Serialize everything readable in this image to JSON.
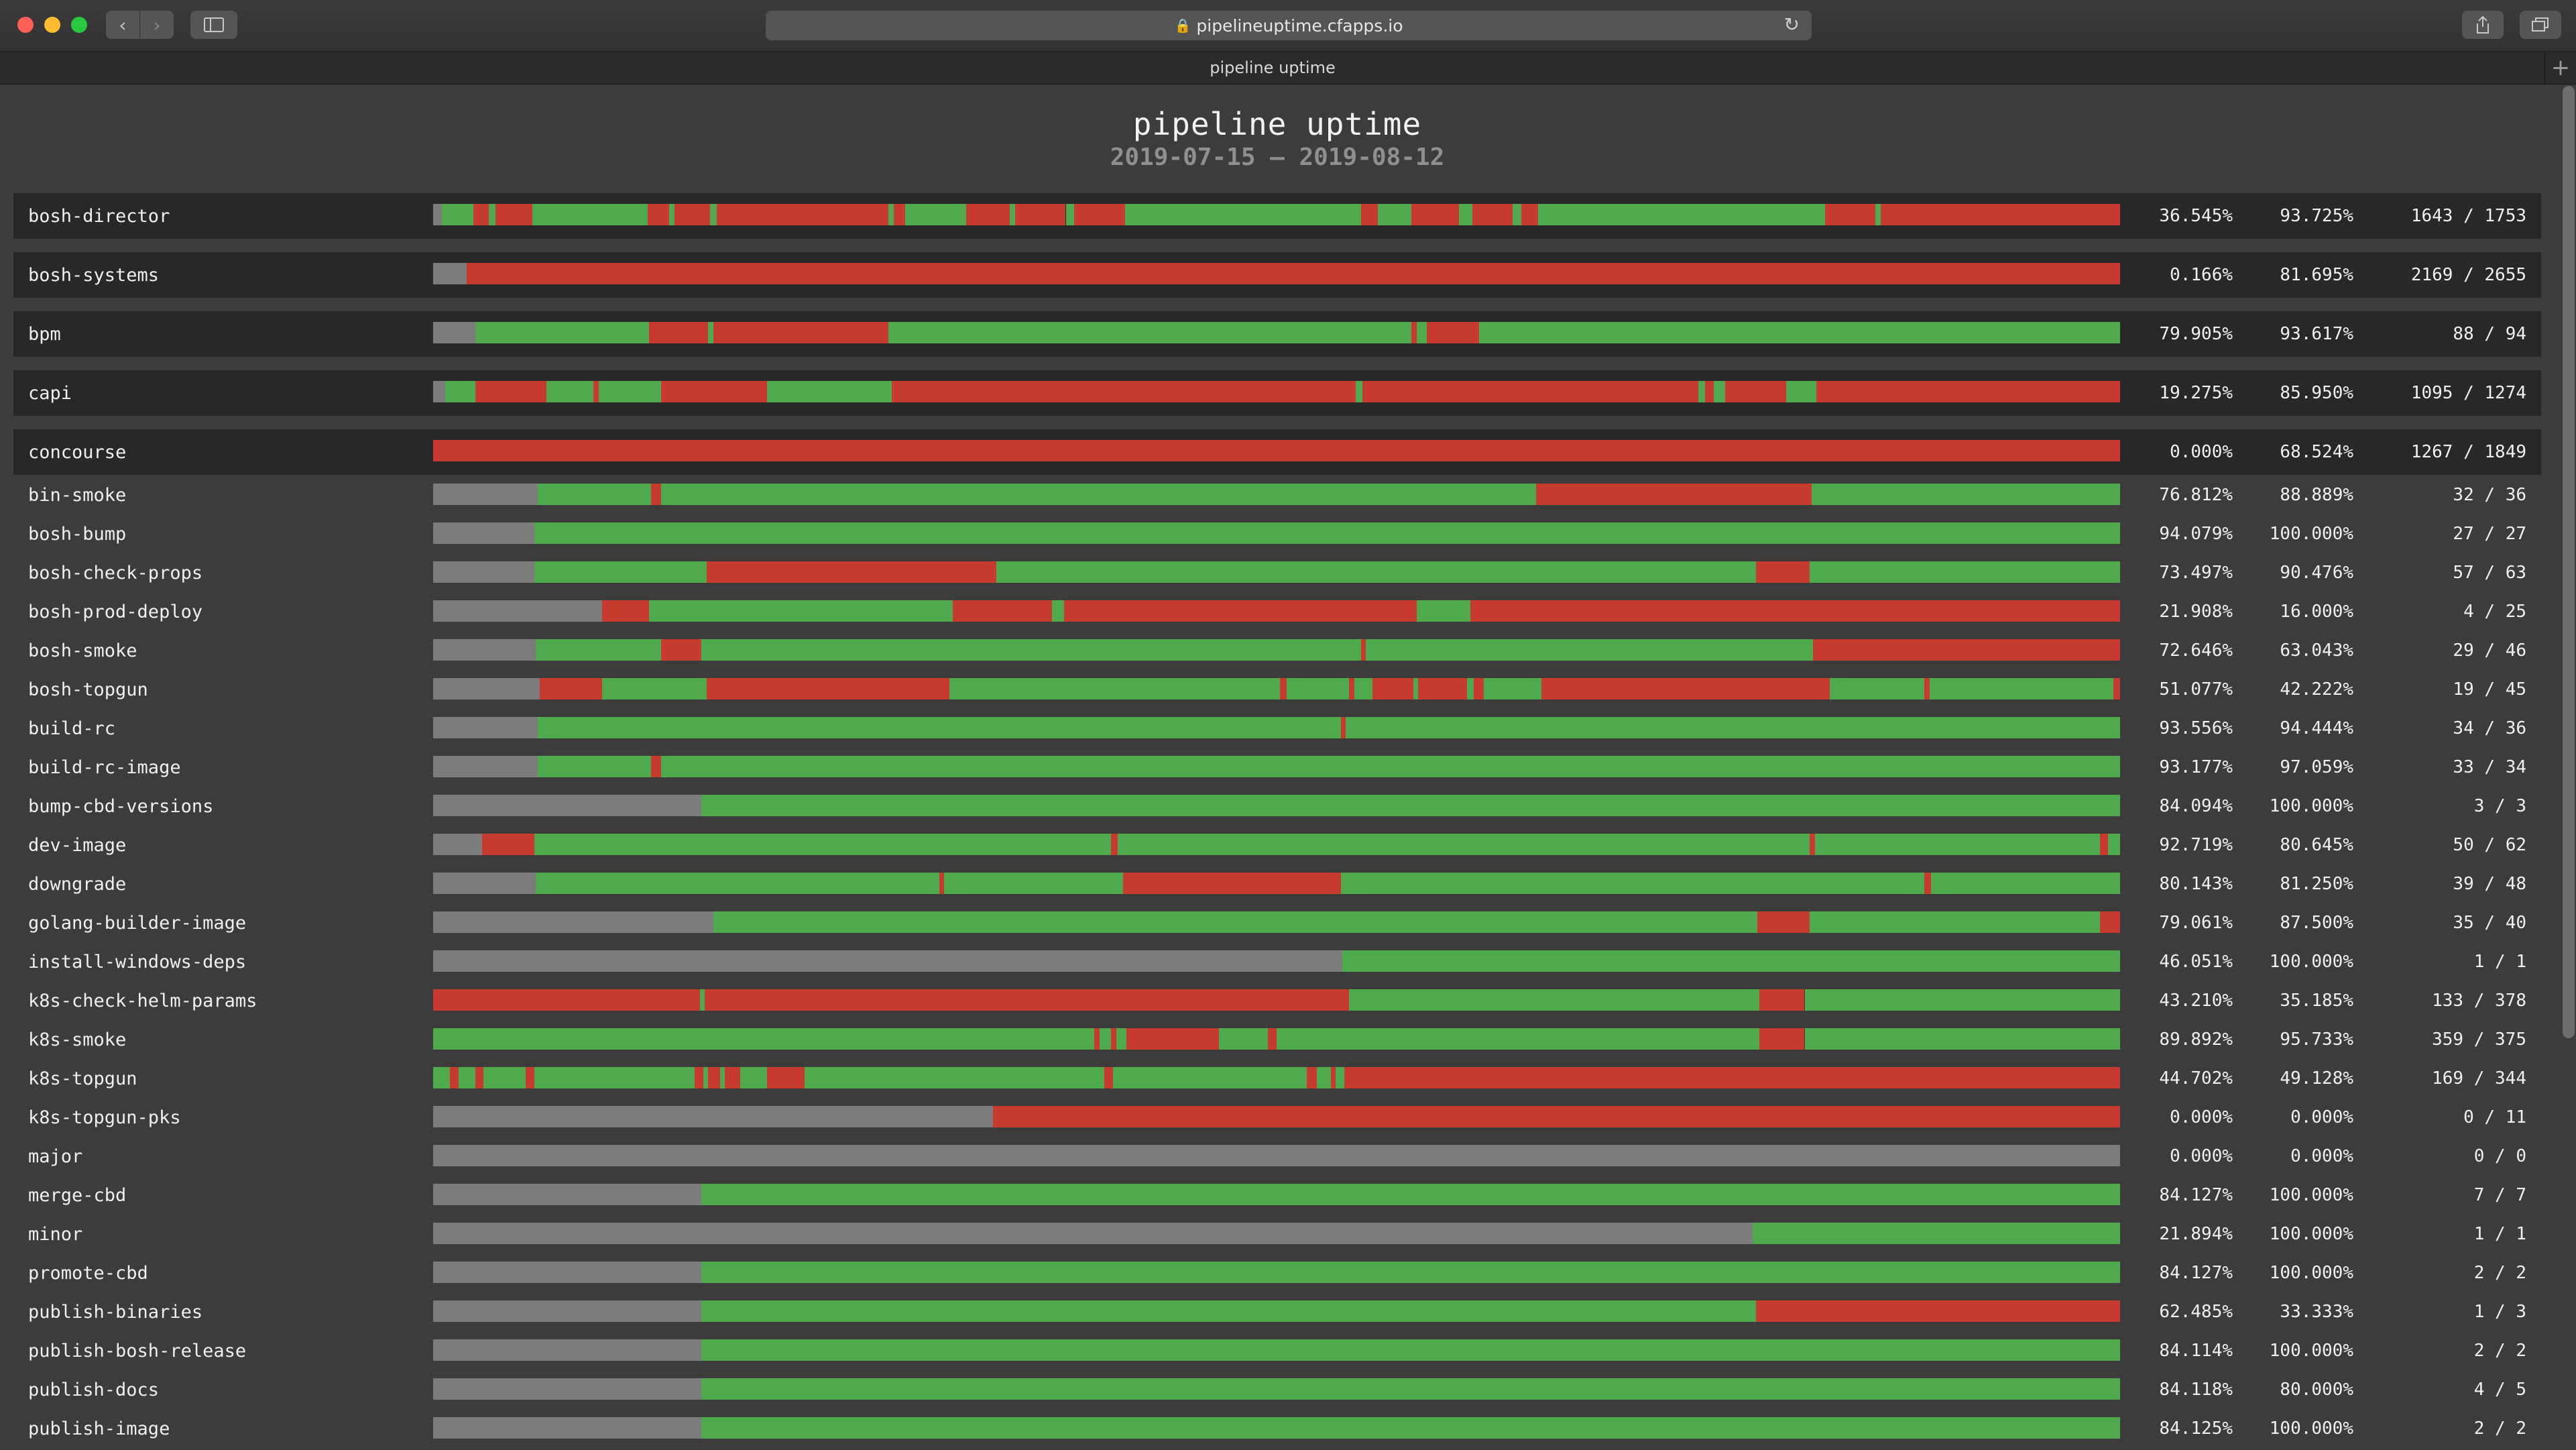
{
  "browser": {
    "url": "pipelineuptime.cfapps.io",
    "tab_title": "pipeline uptime"
  },
  "page": {
    "title": "pipeline uptime",
    "date_range": "2019-07-15 — 2019-08-12"
  },
  "colors": {
    "success": "#4fa94d",
    "failure": "#c63a30",
    "no_data": "#7c7c7c"
  },
  "pipelines": [
    {
      "name": "bosh-director",
      "pct1": "36.545%",
      "pct2": "93.725%",
      "count": "1643 / 1753",
      "timeline": [
        [
          "n",
          0,
          0.5
        ],
        [
          "g",
          0.5,
          2.4
        ],
        [
          "r",
          2.4,
          3.3
        ],
        [
          "g",
          3.3,
          3.7
        ],
        [
          "r",
          3.7,
          5.9
        ],
        [
          "g",
          5.9,
          12.7
        ],
        [
          "r",
          12.7,
          14.0
        ],
        [
          "g",
          14.0,
          14.3
        ],
        [
          "r",
          14.3,
          16.4
        ],
        [
          "g",
          16.4,
          16.8
        ],
        [
          "r",
          16.8,
          27.0
        ],
        [
          "g",
          27.0,
          27.3
        ],
        [
          "r",
          27.3,
          28.0
        ],
        [
          "g",
          28.0,
          31.6
        ],
        [
          "r",
          31.6,
          34.2
        ],
        [
          "g",
          34.2,
          34.5
        ],
        [
          "r",
          34.5,
          37.5
        ],
        [
          "g",
          37.5,
          38.0
        ],
        [
          "r",
          38.0,
          41.0
        ],
        [
          "g",
          41.0,
          55.0
        ],
        [
          "r",
          55.0,
          56.0
        ],
        [
          "g",
          56.0,
          58.0
        ],
        [
          "r",
          58.0,
          60.8
        ],
        [
          "g",
          60.8,
          61.6
        ],
        [
          "r",
          61.6,
          64.0
        ],
        [
          "g",
          64.0,
          64.5
        ],
        [
          "r",
          64.5,
          65.5
        ],
        [
          "g",
          65.5,
          82.5
        ],
        [
          "r",
          82.5,
          85.5
        ],
        [
          "g",
          85.5,
          85.8
        ],
        [
          "r",
          85.8,
          100
        ]
      ]
    },
    {
      "name": "bosh-systems",
      "pct1": "0.166%",
      "pct2": "81.695%",
      "count": "2169 / 2655",
      "timeline": [
        [
          "n",
          0,
          2.0
        ],
        [
          "r",
          2.0,
          100
        ]
      ]
    },
    {
      "name": "bpm",
      "pct1": "79.905%",
      "pct2": "93.617%",
      "count": "88 / 94",
      "timeline": [
        [
          "n",
          0,
          2.5
        ],
        [
          "g",
          2.5,
          12.8
        ],
        [
          "r",
          12.8,
          16.3
        ],
        [
          "g",
          16.3,
          16.6
        ],
        [
          "r",
          16.6,
          27.0
        ],
        [
          "g",
          27.0,
          58.0
        ],
        [
          "r",
          58.0,
          58.3
        ],
        [
          "g",
          58.3,
          58.9
        ],
        [
          "r",
          58.9,
          62.0
        ],
        [
          "g",
          62.0,
          100
        ]
      ]
    },
    {
      "name": "capi",
      "pct1": "19.275%",
      "pct2": "85.950%",
      "count": "1095 / 1274",
      "timeline": [
        [
          "n",
          0,
          0.7
        ],
        [
          "g",
          0.7,
          2.5
        ],
        [
          "r",
          2.5,
          6.7
        ],
        [
          "g",
          6.7,
          9.5
        ],
        [
          "r",
          9.5,
          9.8
        ],
        [
          "g",
          9.8,
          13.5
        ],
        [
          "r",
          13.5,
          19.8
        ],
        [
          "g",
          19.8,
          27.2
        ],
        [
          "r",
          27.2,
          54.7
        ],
        [
          "g",
          54.7,
          55.1
        ],
        [
          "r",
          55.1,
          75.0
        ],
        [
          "g",
          75.0,
          75.4
        ],
        [
          "r",
          75.4,
          75.9
        ],
        [
          "g",
          75.9,
          76.6
        ],
        [
          "r",
          76.6,
          80.2
        ],
        [
          "g",
          80.2,
          82.0
        ],
        [
          "r",
          82.0,
          100
        ]
      ]
    },
    {
      "name": "concourse",
      "pct1": "0.000%",
      "pct2": "68.524%",
      "count": "1267 / 1849",
      "timeline": [
        [
          "r",
          0,
          100
        ]
      ]
    },
    {
      "name": "bin-smoke",
      "pct1": "76.812%",
      "pct2": "88.889%",
      "count": "32 / 36",
      "timeline": [
        [
          "n",
          0,
          6.2
        ],
        [
          "g",
          6.2,
          12.9
        ],
        [
          "r",
          12.9,
          13.5
        ],
        [
          "g",
          13.5,
          65.4
        ],
        [
          "r",
          65.4,
          81.7
        ],
        [
          "g",
          81.7,
          100
        ]
      ]
    },
    {
      "name": "bosh-bump",
      "pct1": "94.079%",
      "pct2": "100.000%",
      "count": "27 / 27",
      "timeline": [
        [
          "n",
          0,
          6.0
        ],
        [
          "g",
          6.0,
          100
        ]
      ]
    },
    {
      "name": "bosh-check-props",
      "pct1": "73.497%",
      "pct2": "90.476%",
      "count": "57 / 63",
      "timeline": [
        [
          "n",
          0,
          6.0
        ],
        [
          "g",
          6.0,
          16.2
        ],
        [
          "r",
          16.2,
          33.4
        ],
        [
          "g",
          33.4,
          78.4
        ],
        [
          "r",
          78.4,
          81.6
        ],
        [
          "g",
          81.6,
          100
        ]
      ]
    },
    {
      "name": "bosh-prod-deploy",
      "pct1": "21.908%",
      "pct2": "16.000%",
      "count": "4 / 25",
      "timeline": [
        [
          "n",
          0,
          10.0
        ],
        [
          "r",
          10.0,
          12.8
        ],
        [
          "g",
          12.8,
          30.8
        ],
        [
          "r",
          30.8,
          36.7
        ],
        [
          "g",
          36.7,
          37.4
        ],
        [
          "r",
          37.4,
          58.3
        ],
        [
          "g",
          58.3,
          61.5
        ],
        [
          "r",
          61.5,
          100
        ]
      ]
    },
    {
      "name": "bosh-smoke",
      "pct1": "72.646%",
      "pct2": "63.043%",
      "count": "29 / 46",
      "timeline": [
        [
          "n",
          0,
          6.1
        ],
        [
          "g",
          6.1,
          13.5
        ],
        [
          "r",
          13.5,
          15.9
        ],
        [
          "g",
          15.9,
          55.0
        ],
        [
          "r",
          55.0,
          55.3
        ],
        [
          "g",
          55.3,
          81.8
        ],
        [
          "r",
          81.8,
          100
        ]
      ]
    },
    {
      "name": "bosh-topgun",
      "pct1": "51.077%",
      "pct2": "42.222%",
      "count": "19 / 45",
      "timeline": [
        [
          "n",
          0,
          6.3
        ],
        [
          "r",
          6.3,
          10.0
        ],
        [
          "g",
          10.0,
          16.2
        ],
        [
          "r",
          16.2,
          30.6
        ],
        [
          "g",
          30.6,
          50.2
        ],
        [
          "r",
          50.2,
          50.6
        ],
        [
          "g",
          50.6,
          54.3
        ],
        [
          "r",
          54.3,
          54.6
        ],
        [
          "g",
          54.6,
          55.7
        ],
        [
          "r",
          55.7,
          58.1
        ],
        [
          "g",
          58.1,
          58.4
        ],
        [
          "r",
          58.4,
          61.3
        ],
        [
          "g",
          61.3,
          61.7
        ],
        [
          "r",
          61.7,
          62.3
        ],
        [
          "g",
          62.3,
          65.7
        ],
        [
          "r",
          65.7,
          82.8
        ],
        [
          "g",
          82.8,
          88.4
        ],
        [
          "r",
          88.4,
          88.7
        ],
        [
          "g",
          88.7,
          99.6
        ],
        [
          "r",
          99.6,
          100
        ]
      ]
    },
    {
      "name": "build-rc",
      "pct1": "93.556%",
      "pct2": "94.444%",
      "count": "34 / 36",
      "timeline": [
        [
          "n",
          0,
          6.2
        ],
        [
          "g",
          6.2,
          53.8
        ],
        [
          "r",
          53.8,
          54.1
        ],
        [
          "g",
          54.1,
          100
        ]
      ]
    },
    {
      "name": "build-rc-image",
      "pct1": "93.177%",
      "pct2": "97.059%",
      "count": "33 / 34",
      "timeline": [
        [
          "n",
          0,
          6.2
        ],
        [
          "g",
          6.2,
          12.9
        ],
        [
          "r",
          12.9,
          13.5
        ],
        [
          "g",
          13.5,
          100
        ]
      ]
    },
    {
      "name": "bump-cbd-versions",
      "pct1": "84.094%",
      "pct2": "100.000%",
      "count": "3 / 3",
      "timeline": [
        [
          "n",
          0,
          15.9
        ],
        [
          "g",
          15.9,
          100
        ]
      ]
    },
    {
      "name": "dev-image",
      "pct1": "92.719%",
      "pct2": "80.645%",
      "count": "50 / 62",
      "timeline": [
        [
          "n",
          0,
          2.9
        ],
        [
          "r",
          2.9,
          6.0
        ],
        [
          "g",
          6.0,
          40.2
        ],
        [
          "r",
          40.2,
          40.6
        ],
        [
          "g",
          40.6,
          81.6
        ],
        [
          "r",
          81.6,
          81.9
        ],
        [
          "g",
          81.9,
          98.8
        ],
        [
          "r",
          98.8,
          99.3
        ],
        [
          "g",
          99.3,
          100
        ]
      ]
    },
    {
      "name": "downgrade",
      "pct1": "80.143%",
      "pct2": "81.250%",
      "count": "39 / 48",
      "timeline": [
        [
          "n",
          0,
          6.1
        ],
        [
          "g",
          6.1,
          30.0
        ],
        [
          "r",
          30.0,
          30.3
        ],
        [
          "g",
          30.3,
          40.9
        ],
        [
          "r",
          40.9,
          53.8
        ],
        [
          "g",
          53.8,
          88.4
        ],
        [
          "r",
          88.4,
          88.8
        ],
        [
          "g",
          88.8,
          100
        ]
      ]
    },
    {
      "name": "golang-builder-image",
      "pct1": "79.061%",
      "pct2": "87.500%",
      "count": "35 / 40",
      "timeline": [
        [
          "n",
          0,
          16.6
        ],
        [
          "g",
          16.6,
          78.5
        ],
        [
          "r",
          78.5,
          81.6
        ],
        [
          "g",
          81.6,
          98.8
        ],
        [
          "r",
          98.8,
          100
        ]
      ]
    },
    {
      "name": "install-windows-deps",
      "pct1": "46.051%",
      "pct2": "100.000%",
      "count": "1 / 1",
      "timeline": [
        [
          "n",
          0,
          53.9
        ],
        [
          "g",
          53.9,
          100
        ]
      ]
    },
    {
      "name": "k8s-check-helm-params",
      "pct1": "43.210%",
      "pct2": "35.185%",
      "count": "133 / 378",
      "timeline": [
        [
          "r",
          0,
          15.8
        ],
        [
          "g",
          15.8,
          16.1
        ],
        [
          "r",
          16.1,
          54.3
        ],
        [
          "g",
          54.3,
          78.6
        ],
        [
          "r",
          78.6,
          81.3
        ],
        [
          "g",
          81.3,
          100
        ]
      ]
    },
    {
      "name": "k8s-smoke",
      "pct1": "89.892%",
      "pct2": "95.733%",
      "count": "359 / 375",
      "timeline": [
        [
          "g",
          0,
          39.2
        ],
        [
          "r",
          39.2,
          39.5
        ],
        [
          "g",
          39.5,
          40.2
        ],
        [
          "r",
          40.2,
          40.5
        ],
        [
          "g",
          40.5,
          41.1
        ],
        [
          "r",
          41.1,
          46.6
        ],
        [
          "g",
          46.6,
          49.5
        ],
        [
          "r",
          49.5,
          50.0
        ],
        [
          "g",
          50.0,
          78.6
        ],
        [
          "r",
          78.6,
          81.3
        ],
        [
          "g",
          81.3,
          100
        ]
      ]
    },
    {
      "name": "k8s-topgun",
      "pct1": "44.702%",
      "pct2": "49.128%",
      "count": "169 / 344",
      "timeline": [
        [
          "g",
          0,
          1.0
        ],
        [
          "r",
          1.0,
          1.5
        ],
        [
          "g",
          1.5,
          2.5
        ],
        [
          "r",
          2.5,
          3.0
        ],
        [
          "g",
          3.0,
          5.5
        ],
        [
          "r",
          5.5,
          6.0
        ],
        [
          "g",
          6.0,
          15.5
        ],
        [
          "r",
          15.5,
          16.0
        ],
        [
          "g",
          16.0,
          16.3
        ],
        [
          "r",
          16.3,
          17.0
        ],
        [
          "g",
          17.0,
          17.3
        ],
        [
          "r",
          17.3,
          18.2
        ],
        [
          "g",
          18.2,
          19.8
        ],
        [
          "r",
          19.8,
          22.0
        ],
        [
          "g",
          22.0,
          39.8
        ],
        [
          "r",
          39.8,
          40.3
        ],
        [
          "g",
          40.3,
          51.8
        ],
        [
          "r",
          51.8,
          52.4
        ],
        [
          "g",
          52.4,
          53.2
        ],
        [
          "r",
          53.2,
          53.5
        ],
        [
          "g",
          53.5,
          54.0
        ],
        [
          "r",
          54.0,
          100
        ]
      ]
    },
    {
      "name": "k8s-topgun-pks",
      "pct1": "0.000%",
      "pct2": "0.000%",
      "count": "0 / 11",
      "timeline": [
        [
          "n",
          0,
          33.2
        ],
        [
          "r",
          33.2,
          100
        ]
      ]
    },
    {
      "name": "major",
      "pct1": "0.000%",
      "pct2": "0.000%",
      "count": "0 / 0",
      "timeline": [
        [
          "n",
          0,
          100
        ]
      ]
    },
    {
      "name": "merge-cbd",
      "pct1": "84.127%",
      "pct2": "100.000%",
      "count": "7 / 7",
      "timeline": [
        [
          "n",
          0,
          15.9
        ],
        [
          "g",
          15.9,
          100
        ]
      ]
    },
    {
      "name": "minor",
      "pct1": "21.894%",
      "pct2": "100.000%",
      "count": "1 / 1",
      "timeline": [
        [
          "n",
          0,
          78.2
        ],
        [
          "g",
          78.2,
          100
        ]
      ]
    },
    {
      "name": "promote-cbd",
      "pct1": "84.127%",
      "pct2": "100.000%",
      "count": "2 / 2",
      "timeline": [
        [
          "n",
          0,
          15.9
        ],
        [
          "g",
          15.9,
          100
        ]
      ]
    },
    {
      "name": "publish-binaries",
      "pct1": "62.485%",
      "pct2": "33.333%",
      "count": "1 / 3",
      "timeline": [
        [
          "n",
          0,
          15.9
        ],
        [
          "g",
          15.9,
          78.4
        ],
        [
          "r",
          78.4,
          100
        ]
      ]
    },
    {
      "name": "publish-bosh-release",
      "pct1": "84.114%",
      "pct2": "100.000%",
      "count": "2 / 2",
      "timeline": [
        [
          "n",
          0,
          15.9
        ],
        [
          "g",
          15.9,
          100
        ]
      ]
    },
    {
      "name": "publish-docs",
      "pct1": "84.118%",
      "pct2": "80.000%",
      "count": "4 / 5",
      "timeline": [
        [
          "n",
          0,
          15.9
        ],
        [
          "g",
          15.9,
          100
        ]
      ]
    },
    {
      "name": "publish-image",
      "pct1": "84.125%",
      "pct2": "100.000%",
      "count": "2 / 2",
      "timeline": [
        [
          "n",
          0,
          15.9
        ],
        [
          "g",
          15.9,
          100
        ]
      ]
    }
  ]
}
